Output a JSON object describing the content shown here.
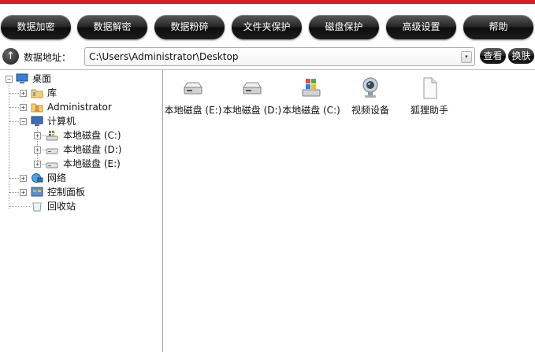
{
  "toolbar": {
    "buttons": [
      "数据加密",
      "数据解密",
      "数据粉碎",
      "文件夹保护",
      "磁盘保护",
      "高级设置",
      "帮助"
    ]
  },
  "address": {
    "up_glyph": "↑",
    "label": "数据地址：",
    "value": "C:\\Users\\Administrator\\Desktop",
    "dropdown_glyph": "▾",
    "view_button": "查看",
    "skin_button": "换肤"
  },
  "tree": {
    "root": "桌面",
    "items": [
      "库",
      "Administrator",
      "计算机",
      "本地磁盘 (C:)",
      "本地磁盘 (D:)",
      "本地磁盘 (E:)",
      "网络",
      "控制面板",
      "回收站"
    ],
    "expand_glyph": "+",
    "collapse_glyph": "−"
  },
  "files": {
    "items": [
      "本地磁盘 (E:)",
      "本地磁盘 (D:)",
      "本地磁盘 (C:)",
      "视频设备",
      "狐狸助手"
    ]
  },
  "colors": {
    "accent_red": "#d61f2b",
    "button_dark": "#1c1c1c"
  }
}
